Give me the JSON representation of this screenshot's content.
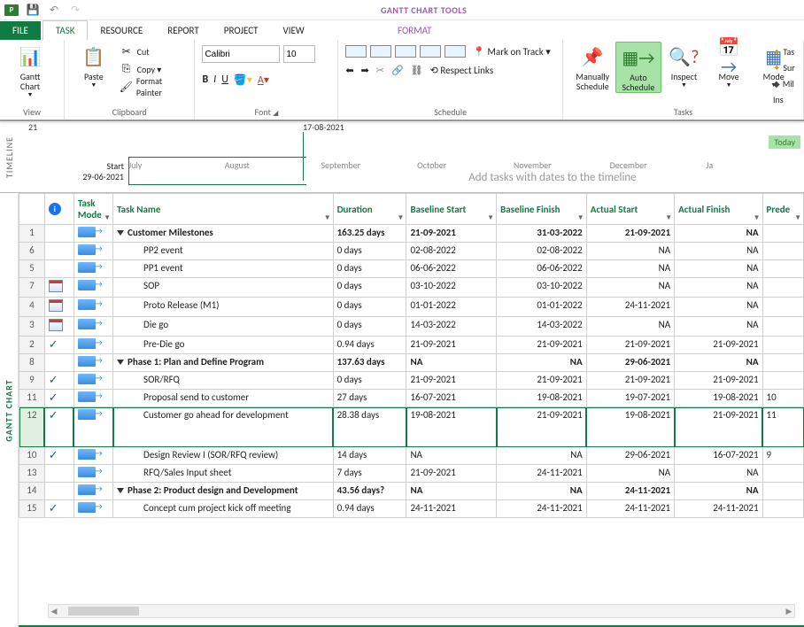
{
  "app": {
    "qat_icon": "P",
    "tool_tab": "GANTT CHART TOOLS"
  },
  "tabs": {
    "file": "FILE",
    "task": "TASK",
    "resource": "RESOURCE",
    "report": "REPORT",
    "project": "PROJECT",
    "view": "VIEW",
    "format": "FORMAT"
  },
  "ribbon": {
    "view": {
      "button": "Gantt\nChart",
      "group": "View"
    },
    "clipboard": {
      "paste": "Paste",
      "cut": "Cut",
      "copy": "Copy",
      "painter": "Format Painter",
      "group": "Clipboard"
    },
    "font": {
      "name": "Calibri",
      "size": "10",
      "group": "Font"
    },
    "schedule": {
      "mark_on_track": "Mark on Track",
      "respect_links": "Respect Links",
      "group": "Schedule"
    },
    "tasks": {
      "manual": "Manually\nSchedule",
      "auto": "Auto\nSchedule",
      "inspect": "Inspect",
      "move": "Move",
      "mode": "Mode",
      "group": "Tasks"
    },
    "far": {
      "tas": "Tas",
      "sur": "Sur",
      "mil": "Mil",
      "ins": "Ins"
    }
  },
  "timeline": {
    "label": "TIMELINE",
    "top_marker": "21",
    "current_marker": "17-08-2021",
    "start_label": "Start",
    "start_date": "29-06-2021",
    "months": [
      "July",
      "August",
      "September",
      "October",
      "November",
      "December",
      "Ja"
    ],
    "hint": "Add tasks with dates to the timeline",
    "today": "Today"
  },
  "grid_label": "GANTT CHART",
  "columns": {
    "info": "ⓘ",
    "mode": "Task Mode",
    "name": "Task Name",
    "duration": "Duration",
    "bstart": "Baseline Start",
    "bfinish": "Baseline Finish",
    "astart": "Actual Start",
    "afinish": "Actual Finish",
    "pred": "Prede"
  },
  "rows": [
    {
      "n": "1",
      "ind": "",
      "name": "Customer Milestones",
      "lvl": 0,
      "sum": true,
      "dur": "163.25 days",
      "bs": "21-09-2021",
      "bf": "31-03-2022",
      "as": "21-09-2021",
      "af": "NA",
      "pr": ""
    },
    {
      "n": "6",
      "ind": "",
      "name": "PP2 event",
      "lvl": 1,
      "dur": "0 days",
      "bs": "02-08-2022",
      "bf": "02-08-2022",
      "as": "NA",
      "af": "NA",
      "pr": ""
    },
    {
      "n": "5",
      "ind": "",
      "name": "PP1 event",
      "lvl": 1,
      "dur": "0 days",
      "bs": "06-06-2022",
      "bf": "06-06-2022",
      "as": "NA",
      "af": "NA",
      "pr": ""
    },
    {
      "n": "7",
      "ind": "cal",
      "name": "SOP",
      "lvl": 1,
      "dur": "0 days",
      "bs": "03-10-2022",
      "bf": "03-10-2022",
      "as": "NA",
      "af": "NA",
      "pr": ""
    },
    {
      "n": "4",
      "ind": "cal",
      "name": "Proto Release (M1)",
      "lvl": 1,
      "dur": "0 days",
      "bs": "01-01-2022",
      "bf": "01-01-2022",
      "as": "24-11-2021",
      "af": "NA",
      "pr": ""
    },
    {
      "n": "3",
      "ind": "cal",
      "name": "Die go",
      "lvl": 1,
      "dur": "0 days",
      "bs": "14-03-2022",
      "bf": "14-03-2022",
      "as": "NA",
      "af": "NA",
      "pr": ""
    },
    {
      "n": "2",
      "ind": "chk",
      "name": "Pre-Die go",
      "lvl": 1,
      "dur": "0.94 days",
      "bs": "21-09-2021",
      "bf": "21-09-2021",
      "as": "21-09-2021",
      "af": "21-09-2021",
      "pr": ""
    },
    {
      "n": "8",
      "ind": "",
      "name": "Phase 1: Plan and Define Program",
      "lvl": 0,
      "sum": true,
      "dur": "137.63 days",
      "bs": "NA",
      "bf": "NA",
      "as": "29-06-2021",
      "af": "NA",
      "pr": ""
    },
    {
      "n": "9",
      "ind": "chk",
      "name": "SOR/RFQ",
      "lvl": 1,
      "dur": "0 days",
      "bs": "21-09-2021",
      "bf": "21-09-2021",
      "as": "21-09-2021",
      "af": "21-09-2021",
      "pr": ""
    },
    {
      "n": "11",
      "ind": "chk",
      "name": "Proposal send to customer",
      "lvl": 1,
      "dur": "27 days",
      "bs": "16-07-2021",
      "bf": "19-08-2021",
      "as": "19-07-2021",
      "af": "19-08-2021",
      "pr": "10"
    },
    {
      "n": "12",
      "ind": "chk",
      "name": "Customer go ahead for development",
      "lvl": 1,
      "sel": true,
      "dur": "28.38 days",
      "bs": "19-08-2021",
      "bf": "21-09-2021",
      "as": "19-08-2021",
      "af": "21-09-2021",
      "pr": "11"
    },
    {
      "n": "10",
      "ind": "chk",
      "name": "Design Review I (SOR/RFQ review)",
      "lvl": 1,
      "dur": "14 days",
      "bs": "NA",
      "bf": "NA",
      "as": "29-06-2021",
      "af": "16-07-2021",
      "pr": "9"
    },
    {
      "n": "13",
      "ind": "",
      "name": "RFQ/Sales Input sheet",
      "lvl": 1,
      "dur": "7 days",
      "bs": "21-09-2021",
      "bf": "24-11-2021",
      "as": "NA",
      "af": "NA",
      "pr": ""
    },
    {
      "n": "14",
      "ind": "",
      "name": "Phase 2: Product design and Development",
      "lvl": 0,
      "sum": true,
      "dur": "43.56 days?",
      "bs": "NA",
      "bf": "NA",
      "as": "24-11-2021",
      "af": "NA",
      "pr": ""
    },
    {
      "n": "15",
      "ind": "chk",
      "name": "Concept cum project kick off meeting",
      "lvl": 1,
      "dur": "0.94 days",
      "bs": "24-11-2021",
      "bf": "24-11-2021",
      "as": "24-11-2021",
      "af": "24-11-2021",
      "pr": ""
    }
  ]
}
